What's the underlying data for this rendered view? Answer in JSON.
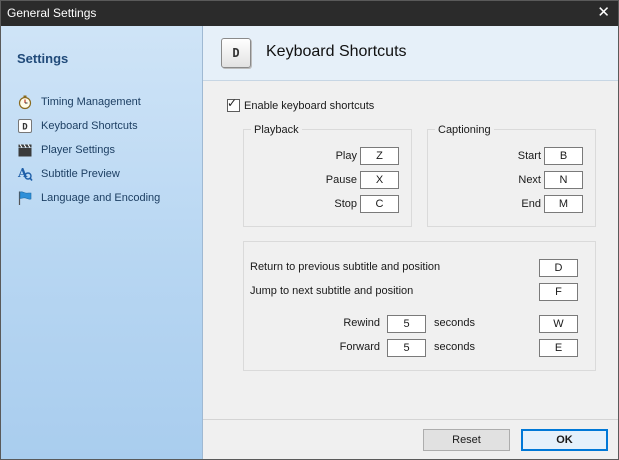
{
  "window": {
    "title": "General Settings",
    "close_glyph": "✕"
  },
  "sidebar": {
    "heading": "Settings",
    "items": [
      {
        "label": "Timing Management",
        "icon": "stopwatch-icon"
      },
      {
        "label": "Keyboard Shortcuts",
        "icon": "keyboard-key-icon"
      },
      {
        "label": "Player Settings",
        "icon": "clapperboard-icon"
      },
      {
        "label": "Subtitle Preview",
        "icon": "subtitle-preview-icon"
      },
      {
        "label": "Language and Encoding",
        "icon": "flag-icon"
      }
    ]
  },
  "header": {
    "key_glyph": "D",
    "title": "Keyboard Shortcuts"
  },
  "enable_shortcuts": {
    "label": "Enable keyboard shortcuts",
    "checked": true,
    "tick": "✓"
  },
  "playback": {
    "title": "Playback",
    "rows": [
      {
        "label": "Play",
        "key": "Z"
      },
      {
        "label": "Pause",
        "key": "X"
      },
      {
        "label": "Stop",
        "key": "C"
      }
    ]
  },
  "captioning": {
    "title": "Captioning",
    "rows": [
      {
        "label": "Start",
        "key": "B"
      },
      {
        "label": "Next",
        "key": "N"
      },
      {
        "label": "End",
        "key": "M"
      }
    ]
  },
  "navigation": {
    "return_label": "Return to previous subtitle and position",
    "return_key": "D",
    "jump_label": "Jump to next subtitle and position",
    "jump_key": "F",
    "rewind_label": "Rewind",
    "rewind_value": "5",
    "rewind_unit": "seconds",
    "rewind_key": "W",
    "forward_label": "Forward",
    "forward_value": "5",
    "forward_unit": "seconds",
    "forward_key": "E"
  },
  "footer": {
    "reset_label": "Reset",
    "ok_label": "OK"
  },
  "colors": {
    "accent": "#0078d7",
    "sidebar": "#b7d6f2",
    "titlebar": "#2b2b2b"
  }
}
